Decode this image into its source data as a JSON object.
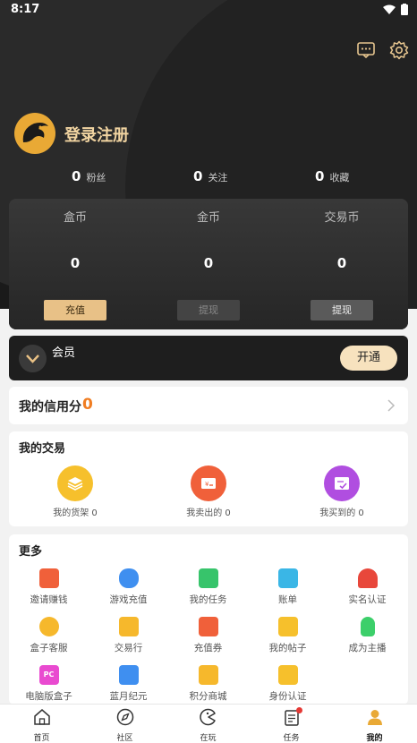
{
  "status": {
    "time": "8:17"
  },
  "profile": {
    "login_label": "登录注册"
  },
  "stats": [
    {
      "value": "0",
      "label": "粉丝"
    },
    {
      "value": "0",
      "label": "关注"
    },
    {
      "value": "0",
      "label": "收藏"
    }
  ],
  "wallet": [
    {
      "label": "盒币",
      "value": "0",
      "button": "充值"
    },
    {
      "label": "金币",
      "value": "0",
      "button": "提现"
    },
    {
      "label": "交易币",
      "value": "0",
      "button": "提现"
    }
  ],
  "vip": {
    "label": "会员",
    "button": "开通"
  },
  "credit": {
    "label": "我的信用分",
    "value": "0"
  },
  "trade": {
    "title": "我的交易",
    "items": [
      {
        "label": "我的货架 0",
        "icon": "shelf-icon"
      },
      {
        "label": "我卖出的 0",
        "icon": "sold-icon"
      },
      {
        "label": "我买到的 0",
        "icon": "bought-icon"
      }
    ]
  },
  "more": {
    "title": "更多",
    "items": [
      {
        "label": "邀请赚钱",
        "icon": "invite-icon"
      },
      {
        "label": "游戏充值",
        "icon": "gamepad-icon"
      },
      {
        "label": "我的任务",
        "icon": "calendar-icon"
      },
      {
        "label": "账单",
        "icon": "bill-icon"
      },
      {
        "label": "实名认证",
        "icon": "verify-icon"
      },
      {
        "label": "盒子客服",
        "icon": "support-icon"
      },
      {
        "label": "交易行",
        "icon": "shop-icon"
      },
      {
        "label": "充值券",
        "icon": "coupon-icon"
      },
      {
        "label": "我的帖子",
        "icon": "post-icon"
      },
      {
        "label": "成为主播",
        "icon": "mic-icon"
      },
      {
        "label": "电脑版盒子",
        "icon": "pc-icon"
      },
      {
        "label": "蓝月纪元",
        "icon": "book-icon"
      },
      {
        "label": "积分商城",
        "icon": "points-icon"
      },
      {
        "label": "身份认证",
        "icon": "id-icon"
      }
    ]
  },
  "tabs": [
    {
      "label": "首页",
      "icon": "home-icon"
    },
    {
      "label": "社区",
      "icon": "compass-icon"
    },
    {
      "label": "在玩",
      "icon": "play-icon"
    },
    {
      "label": "任务",
      "icon": "task-icon"
    },
    {
      "label": "我的",
      "icon": "user-icon"
    }
  ],
  "colors": {
    "accent": "#f07d22",
    "gold": "#e9a935",
    "dark": "#1a1a1a"
  }
}
